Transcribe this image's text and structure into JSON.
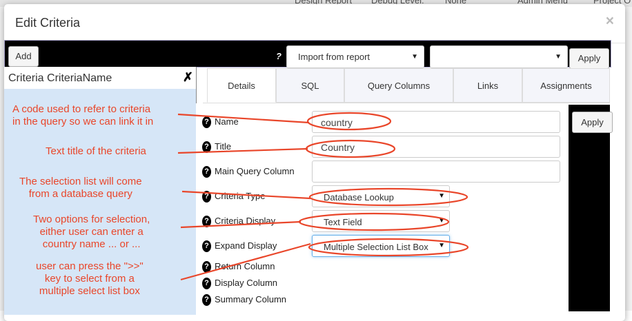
{
  "background": {
    "nav_items": [
      "Design Report",
      "Debug Level:",
      "None",
      "Admin Menu",
      "Project O"
    ]
  },
  "modal": {
    "title": "Edit Criteria",
    "close_symbol": "×"
  },
  "toolbar": {
    "add_label": "Add",
    "help_symbol": "?",
    "import_select": "Import from report",
    "second_select": "",
    "apply_label": "Apply"
  },
  "criteria_list": {
    "current": "Criteria CriteriaName",
    "delete_symbol": "✗"
  },
  "tabs": [
    {
      "label": "Details",
      "active": true
    },
    {
      "label": "SQL",
      "active": false
    },
    {
      "label": "Query Columns",
      "active": false
    },
    {
      "label": "Links",
      "active": false
    },
    {
      "label": "Assignments",
      "active": false
    }
  ],
  "form": {
    "apply_label": "Apply",
    "help_symbol": "?",
    "name": {
      "label": "Name",
      "value": "country"
    },
    "title": {
      "label": "Title",
      "value": "Country"
    },
    "main_query_column": {
      "label": "Main Query Column",
      "value": ""
    },
    "criteria_type": {
      "label": "Criteria Type",
      "value": "Database Lookup"
    },
    "criteria_display": {
      "label": "Criteria Display",
      "value": "Text Field"
    },
    "expand_display": {
      "label": "Expand Display",
      "value": "Multiple Selection List Box"
    },
    "return_column": {
      "label": "Return Column"
    },
    "display_column": {
      "label": "Display Column"
    },
    "summary_column": {
      "label": "Summary Column"
    }
  },
  "annotations": {
    "name_note": "A code used to refer to criteria\nin the query so we can link it in",
    "title_note": "Text title of the criteria",
    "type_note": "The selection list will come\nfrom a database query",
    "display_note": "Two options for selection,\neither user can enter a\ncountry name ... or ...",
    "expand_note": "user can press the \">>\"\nkey to select from a\nmultiple select list box",
    "color": "#e9462a"
  },
  "colors": {
    "toolbar_bg": "#000000",
    "left_panel_bg": "#d6e6f7",
    "tab_bg": "#f4f5fa",
    "annotation": "#e9462a"
  }
}
